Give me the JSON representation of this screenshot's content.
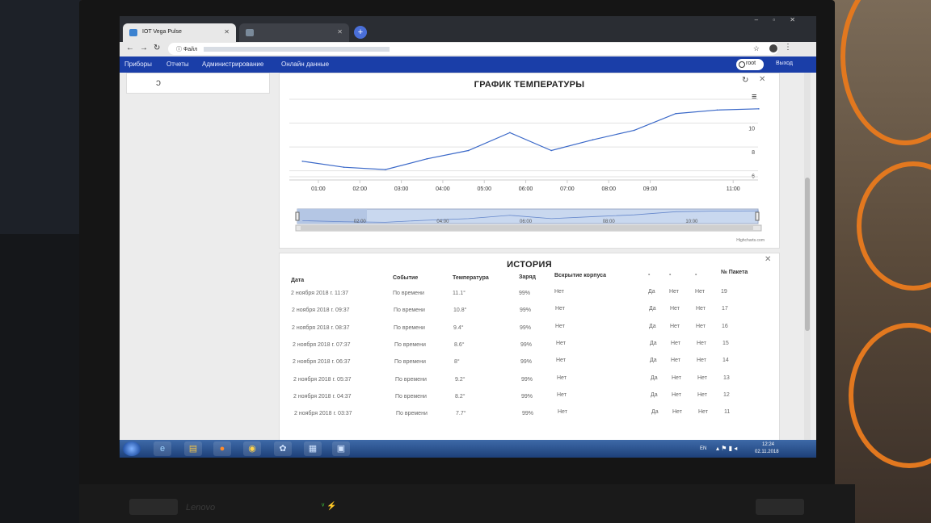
{
  "browser": {
    "active_tab_title": "IOT Vega Pulse",
    "inactive_tab_title": "",
    "address_label": "ⓘ Файл"
  },
  "app_nav": {
    "items": [
      "Приборы",
      "Отчеты",
      "Администрирование",
      "Онлайн данные"
    ],
    "user": "root",
    "logout": "Выход"
  },
  "chart_panel": {
    "title": "ГРАФИК ТЕМПЕРАТУРЫ",
    "credits": "Highcharts.com",
    "navigator_labels": [
      "02:00",
      "04:00",
      "06:00",
      "08:00",
      "10:00"
    ]
  },
  "chart_data": {
    "type": "line",
    "title": "ГРАФИК ТЕМПЕРАТУРЫ",
    "xlabel": "",
    "ylabel": "",
    "x": [
      "00:37",
      "01:37",
      "02:37",
      "03:37",
      "04:37",
      "05:37",
      "06:37",
      "07:37",
      "08:37",
      "09:37",
      "10:37",
      "11:37"
    ],
    "series": [
      {
        "values": [
          6.8,
          6.3,
          6.1,
          7.0,
          7.7,
          9.2,
          7.7,
          8.6,
          9.4,
          10.8,
          11.1,
          11.2
        ]
      }
    ],
    "x_tick_labels": [
      "01:00",
      "02:00",
      "03:00",
      "04:00",
      "05:00",
      "06:00",
      "07:00",
      "08:00",
      "09:00",
      "11:00"
    ],
    "y_tick_labels": [
      "6",
      "8",
      "10"
    ],
    "ylim": [
      5.5,
      12
    ],
    "grid": true,
    "legend": "none"
  },
  "history_panel": {
    "title": "ИСТОРИЯ",
    "columns": [
      "Дата",
      "Событие",
      "Температура",
      "Заряд",
      "Вскрытие корпуса",
      "-",
      "-",
      "-",
      "№ Пакета"
    ],
    "rows": [
      [
        "2 ноября 2018 г. 11:37",
        "По времени",
        "11.1°",
        "99%",
        "Нет",
        "Да",
        "Нет",
        "Нет",
        "19"
      ],
      [
        "2 ноября 2018 г. 09:37",
        "По времени",
        "10.8°",
        "99%",
        "Нет",
        "Да",
        "Нет",
        "Нет",
        "17"
      ],
      [
        "2 ноября 2018 г. 08:37",
        "По времени",
        "9.4°",
        "99%",
        "Нет",
        "Да",
        "Нет",
        "Нет",
        "16"
      ],
      [
        "2 ноября 2018 г. 07:37",
        "По времени",
        "8.6°",
        "99%",
        "Нет",
        "Да",
        "Нет",
        "Нет",
        "15"
      ],
      [
        "2 ноября 2018 г. 06:37",
        "По времени",
        "8°",
        "99%",
        "Нет",
        "Да",
        "Нет",
        "Нет",
        "14"
      ],
      [
        "2 ноября 2018 г. 05:37",
        "По времени",
        "9.2°",
        "99%",
        "Нет",
        "Да",
        "Нет",
        "Нет",
        "13"
      ],
      [
        "2 ноября 2018 г. 04:37",
        "По времени",
        "8.2°",
        "99%",
        "Нет",
        "Да",
        "Нет",
        "Нет",
        "12"
      ],
      [
        "2 ноября 2018 г. 03:37",
        "По времени",
        "7.7°",
        "99%",
        "Нет",
        "Да",
        "Нет",
        "Нет",
        "11"
      ]
    ]
  },
  "taskbar": {
    "lang": "EN",
    "time": "12:24",
    "date": "02.11.2018"
  },
  "laptop": {
    "brand": "Lenovo"
  },
  "colors": {
    "nav": "#1a3ea8",
    "series": "#3a68c8",
    "taskbar": "#2a5393"
  }
}
